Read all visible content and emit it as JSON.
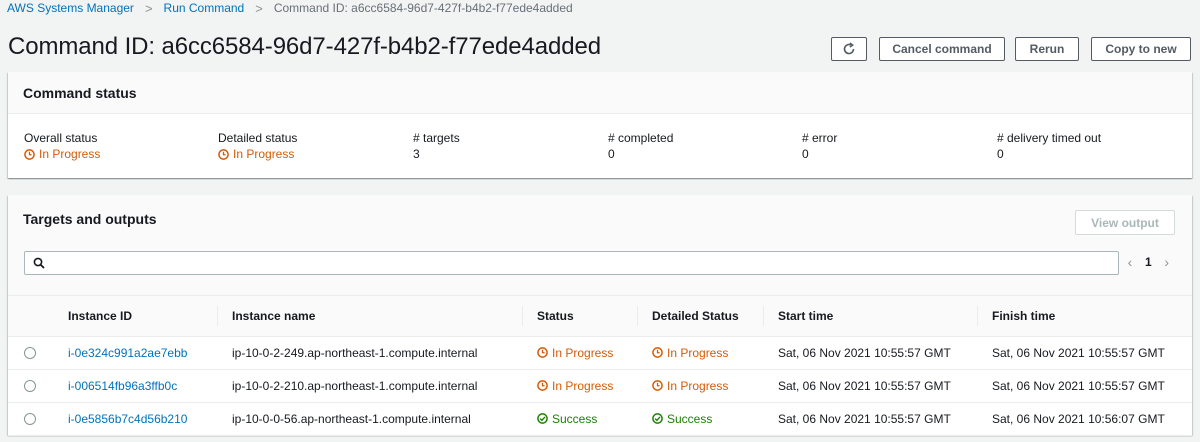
{
  "breadcrumb": {
    "items": [
      "AWS Systems Manager",
      "Run Command"
    ],
    "current": "Command ID: a6cc6584-96d7-427f-b4b2-f77ede4added"
  },
  "page_title": "Command ID: a6cc6584-96d7-427f-b4b2-f77ede4added",
  "header_buttons": {
    "refresh_icon": "refresh-icon",
    "cancel": "Cancel command",
    "rerun": "Rerun",
    "copy": "Copy to new"
  },
  "command_status": {
    "title": "Command status",
    "stats": [
      {
        "label": "Overall status",
        "value": "In Progress",
        "kind": "progress"
      },
      {
        "label": "Detailed status",
        "value": "In Progress",
        "kind": "progress"
      },
      {
        "label": "# targets",
        "value": "3",
        "kind": "plain"
      },
      {
        "label": "# completed",
        "value": "0",
        "kind": "plain"
      },
      {
        "label": "# error",
        "value": "0",
        "kind": "plain"
      },
      {
        "label": "# delivery timed out",
        "value": "0",
        "kind": "plain"
      }
    ]
  },
  "targets": {
    "title": "Targets and outputs",
    "view_output": "View output",
    "search_placeholder": "",
    "page": "1",
    "columns": [
      "Instance ID",
      "Instance name",
      "Status",
      "Detailed Status",
      "Start time",
      "Finish time"
    ],
    "rows": [
      {
        "id": "i-0e324c991a2ae7ebb",
        "name": "ip-10-0-2-249.ap-northeast-1.compute.internal",
        "status": "In Progress",
        "detailed": "In Progress",
        "kind": "progress",
        "start": "Sat, 06 Nov 2021 10:55:57 GMT",
        "finish": "Sat, 06 Nov 2021 10:55:57 GMT"
      },
      {
        "id": "i-006514fb96a3ffb0c",
        "name": "ip-10-0-2-210.ap-northeast-1.compute.internal",
        "status": "In Progress",
        "detailed": "In Progress",
        "kind": "progress",
        "start": "Sat, 06 Nov 2021 10:55:57 GMT",
        "finish": "Sat, 06 Nov 2021 10:55:57 GMT"
      },
      {
        "id": "i-0e5856b7c4d56b210",
        "name": "ip-10-0-0-56.ap-northeast-1.compute.internal",
        "status": "Success",
        "detailed": "Success",
        "kind": "success",
        "start": "Sat, 06 Nov 2021 10:55:57 GMT",
        "finish": "Sat, 06 Nov 2021 10:56:07 GMT"
      }
    ]
  },
  "colors": {
    "link": "#0073bb",
    "progress": "#d45b07",
    "success": "#1d8102"
  }
}
